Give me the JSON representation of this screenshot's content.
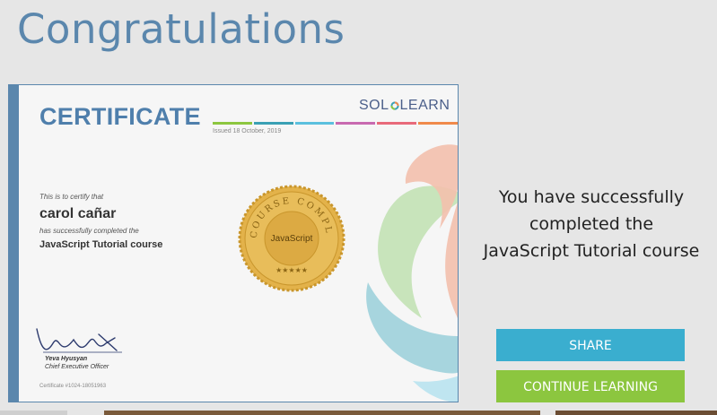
{
  "page": {
    "title": "Congratulations"
  },
  "certificate": {
    "heading": "CERTIFICATE",
    "logo": {
      "left": "SOL",
      "right": "LEARN"
    },
    "issued": "Issued 18 October, 2019",
    "certify_text": "This is to certify that",
    "recipient": "carol cañar",
    "completed_text": "has successfully completed the",
    "course": "JavaScript Tutorial course",
    "seal": {
      "top_text": "COURSE COMPLETED",
      "center_text": "JavaScript",
      "stars": "★★★★★"
    },
    "signer_name": "Yeva Hyusyan",
    "signer_title": "Chief Executive Officer",
    "number": "Certificate #1024-18051963",
    "colors": {
      "accent": "#5b87ad",
      "heading": "#4f7fac",
      "gold": "#d6a93a",
      "stripe": [
        "#8cc63f",
        "#3aa0b4",
        "#5bc0de",
        "#c86ab0",
        "#e86a7a",
        "#f08a4b"
      ]
    }
  },
  "message": {
    "line1": "You have successfully",
    "line2": "completed the",
    "line3": "JavaScript Tutorial course"
  },
  "buttons": {
    "share": "SHARE",
    "continue": "CONTINUE LEARNING",
    "share_color": "#3aaecf",
    "continue_color": "#8cc63f"
  }
}
